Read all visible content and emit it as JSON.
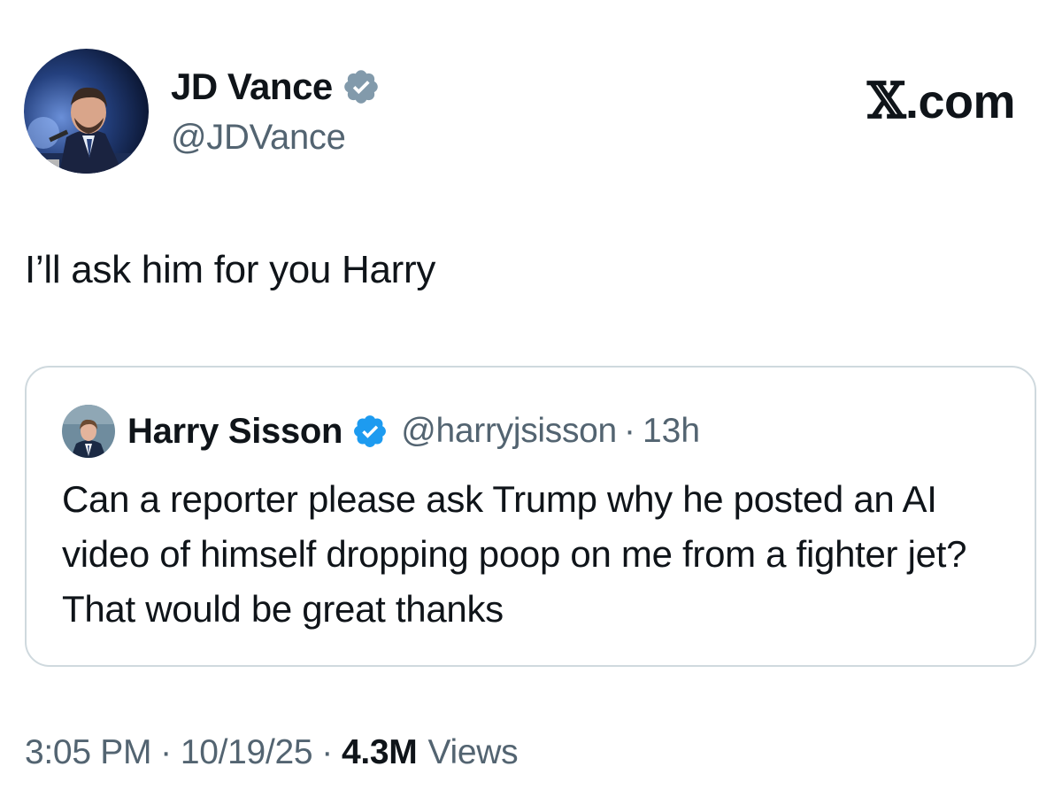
{
  "author": {
    "display_name": "JD Vance",
    "handle": "@JDVance",
    "verified_badge": "gray-verified-badge-icon",
    "badge_color": "#829aab"
  },
  "brand": {
    "x_glyph": "𝕏",
    "domain_suffix": ".com"
  },
  "tweet": {
    "text": "I’ll ask him for you Harry"
  },
  "quoted_tweet": {
    "display_name": "Harry Sisson",
    "handle": "@harryjsisson",
    "separator": "·",
    "time_ago": "13h",
    "verified_badge": "blue-verified-badge-icon",
    "badge_color": "#1d9bf0",
    "text": "Can a reporter please ask Trump why he posted an AI video of himself dropping poop on me from a fighter jet? That would be great thanks"
  },
  "meta": {
    "time": "3:05 PM",
    "separator": "·",
    "date": "10/19/25",
    "views_count": "4.3M",
    "views_label": "Views"
  },
  "colors": {
    "text_primary": "#0f1419",
    "text_secondary": "#536471",
    "border": "#cfd9de"
  }
}
